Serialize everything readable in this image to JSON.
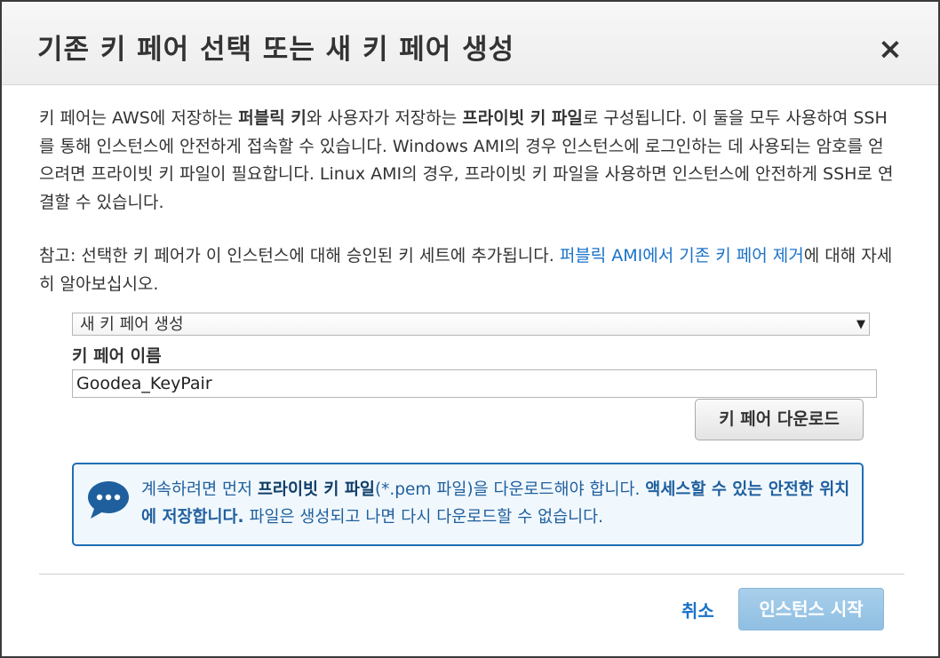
{
  "dialog": {
    "title": "기존 키 페어 선택 또는 새 키 페어 생성",
    "close_label": "×"
  },
  "intro": {
    "t1": "키 페어는 AWS에 저장하는 ",
    "b1": "퍼블릭 키",
    "t2": "와 사용자가 저장하는 ",
    "b2": "프라이빗 키 파일",
    "t3": "로 구성됩니다. 이 둘을 모두 사용하여 SSH를 통해 인스턴스에 안전하게 접속할 수 있습니다. Windows AMI의 경우 인스턴스에 로그인하는 데 사용되는 암호를 얻으려면 프라이빗 키 파일이 필요합니다. Linux AMI의 경우, 프라이빗 키 파일을 사용하면 인스턴스에 안전하게 SSH로 연결할 수 있습니다."
  },
  "note": {
    "t1": "참고: 선택한 키 페어가 이 인스턴스에 대해 승인된 키 세트에 추가됩니다. ",
    "link": "퍼블릭 AMI에서 기존 키 페어 제거",
    "t2": "에 대해 자세히 알아보십시오."
  },
  "key_pair_select": {
    "selected": "새 키 페어 생성",
    "arrow": "▼"
  },
  "key_pair_name": {
    "label": "키 페어 이름",
    "value": "Goodea_KeyPair"
  },
  "download_button": "키 페어 다운로드",
  "info": {
    "t1": "계속하려면 먼저 ",
    "b1": "프라이빗 키 파일",
    "t2": "(*.pem 파일)을 다운로드해야 합니다. ",
    "b2": "액세스할 수 있는 안전한 위치에 저장합니다.",
    "t3": " 파일은 생성되고 나면 다시 다운로드할 수 없습니다."
  },
  "footer": {
    "cancel": "취소",
    "launch": "인스턴스 시작"
  },
  "colors": {
    "link": "#1a73c8",
    "info_border": "#1f6eb5",
    "info_icon": "#1f5f9e",
    "launch_button": "#9ec8e8"
  },
  "icons": {
    "info": "chat-bubble-icon",
    "close": "close-icon",
    "select_arrow": "chevron-down-icon"
  }
}
